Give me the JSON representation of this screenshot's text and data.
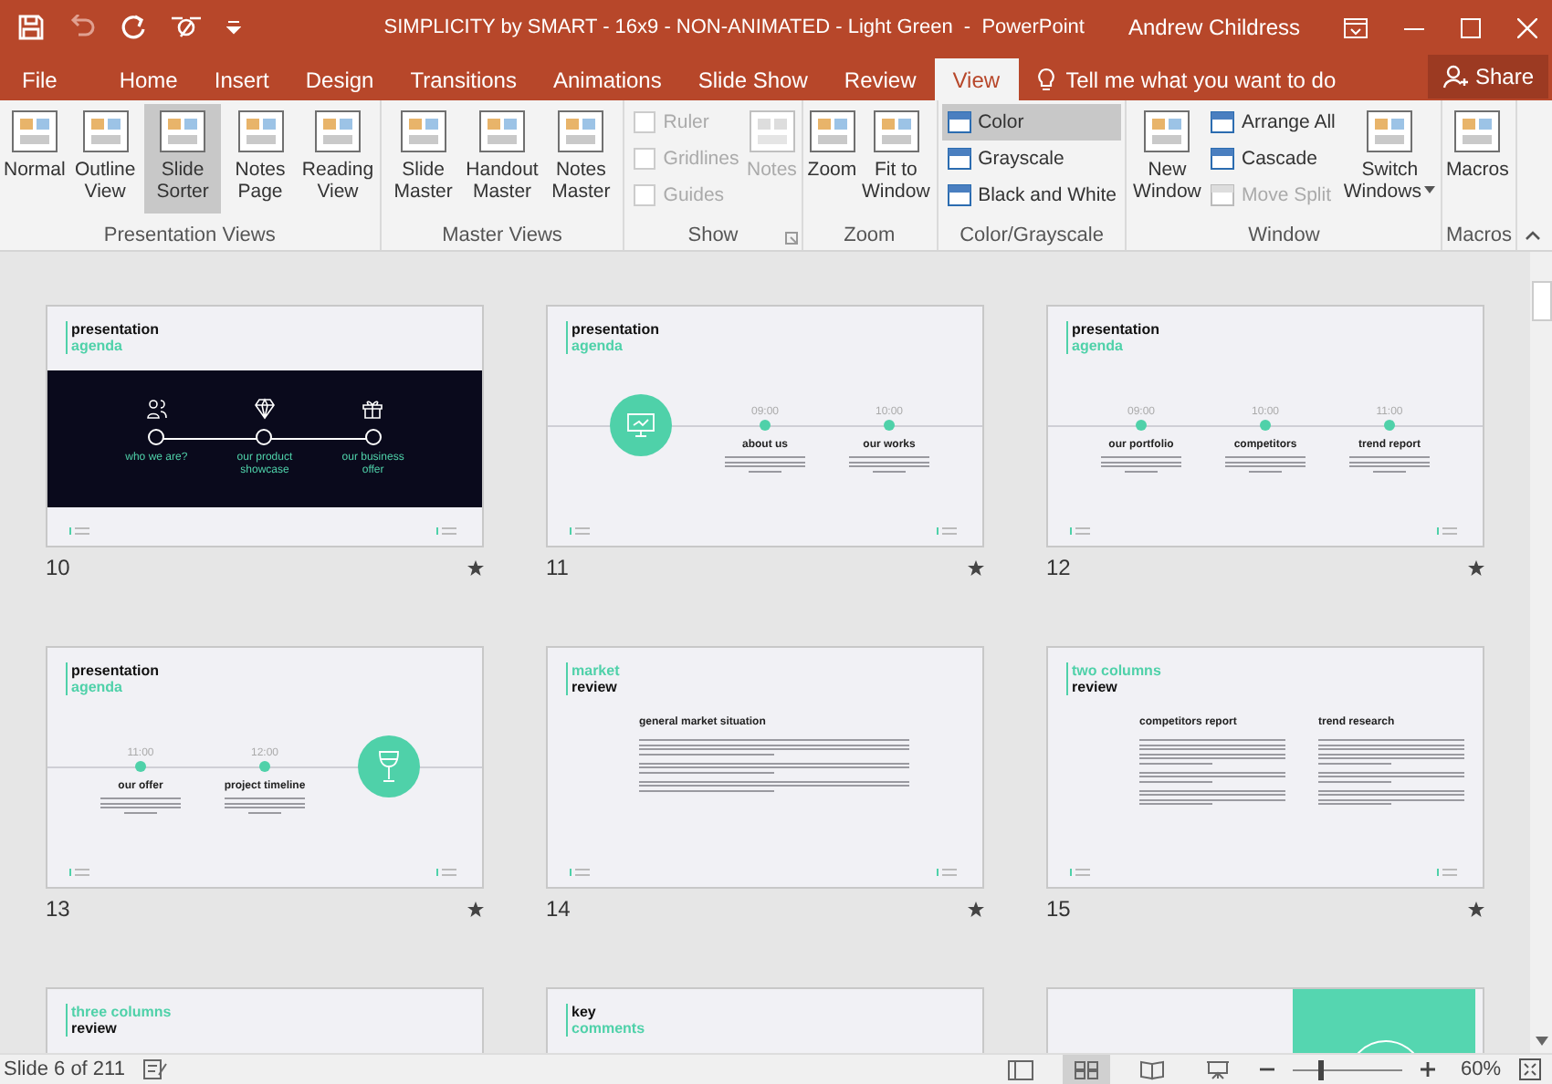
{
  "title_bar": {
    "title": "SIMPLICITY by SMART - 16x9 - NON-ANIMATED - Light Green  -  PowerPoint",
    "user": "Andrew Childress"
  },
  "tabs": [
    {
      "label": "File",
      "selected": false
    },
    {
      "label": "Home",
      "selected": false
    },
    {
      "label": "Insert",
      "selected": false
    },
    {
      "label": "Design",
      "selected": false
    },
    {
      "label": "Transitions",
      "selected": false
    },
    {
      "label": "Animations",
      "selected": false
    },
    {
      "label": "Slide Show",
      "selected": false
    },
    {
      "label": "Review",
      "selected": false
    },
    {
      "label": "View",
      "selected": true
    }
  ],
  "tell_me": {
    "placeholder": "Tell me what you want to do"
  },
  "share": "Share",
  "ribbon": {
    "groups": [
      {
        "label": "Presentation Views",
        "columns": [
          [
            {
              "kind": "large",
              "label": "Normal",
              "selected": false,
              "disabled": false
            }
          ],
          [
            {
              "kind": "large",
              "label": "Outline View",
              "selected": false,
              "disabled": false
            }
          ],
          [
            {
              "kind": "large",
              "label": "Slide Sorter",
              "selected": true,
              "disabled": false
            }
          ],
          [
            {
              "kind": "large",
              "label": "Notes Page",
              "selected": false,
              "disabled": false
            }
          ],
          [
            {
              "kind": "large",
              "label": "Reading View",
              "selected": false,
              "disabled": false
            }
          ]
        ]
      },
      {
        "label": "Master Views",
        "columns": [
          [
            {
              "kind": "large",
              "label": "Slide Master",
              "selected": false,
              "disabled": false
            }
          ],
          [
            {
              "kind": "large",
              "label": "Handout Master",
              "selected": false,
              "disabled": false
            }
          ],
          [
            {
              "kind": "large",
              "label": "Notes Master",
              "selected": false,
              "disabled": false
            }
          ]
        ]
      },
      {
        "label": "Show",
        "dialog_launcher": true,
        "columns": [
          [
            {
              "kind": "check",
              "label": "Ruler",
              "checked": false,
              "disabled": true
            },
            {
              "kind": "check",
              "label": "Gridlines",
              "checked": false,
              "disabled": true
            },
            {
              "kind": "check",
              "label": "Guides",
              "checked": false,
              "disabled": true
            }
          ],
          [
            {
              "kind": "large",
              "label": "Notes",
              "selected": false,
              "disabled": true
            }
          ]
        ]
      },
      {
        "label": "Zoom",
        "columns": [
          [
            {
              "kind": "large",
              "label": "Zoom",
              "selected": false,
              "disabled": false
            }
          ],
          [
            {
              "kind": "large",
              "label": "Fit to Window",
              "selected": false,
              "disabled": false
            }
          ]
        ]
      },
      {
        "label": "Color/Grayscale",
        "columns": [
          [
            {
              "kind": "small",
              "label": "Color",
              "selected": true,
              "disabled": false
            },
            {
              "kind": "small",
              "label": "Grayscale",
              "selected": false,
              "disabled": false
            },
            {
              "kind": "small",
              "label": "Black and White",
              "selected": false,
              "disabled": false
            }
          ]
        ]
      },
      {
        "label": "Window",
        "columns": [
          [
            {
              "kind": "large",
              "label": "New Window",
              "selected": false,
              "disabled": false
            }
          ],
          [
            {
              "kind": "small",
              "label": "Arrange All",
              "selected": false,
              "disabled": false
            },
            {
              "kind": "small",
              "label": "Cascade",
              "selected": false,
              "disabled": false
            },
            {
              "kind": "small",
              "label": "Move Split",
              "selected": false,
              "disabled": true
            }
          ],
          [
            {
              "kind": "large",
              "label": "Switch Windows",
              "selected": false,
              "disabled": false,
              "dropdown": true
            }
          ]
        ]
      },
      {
        "label": "Macros",
        "columns": [
          [
            {
              "kind": "large",
              "label": "Macros",
              "selected": false,
              "disabled": false
            }
          ]
        ]
      }
    ]
  },
  "slides": [
    {
      "number": "10",
      "transition": true,
      "kind": "banner",
      "title": [
        {
          "text": "presentation",
          "accent": false
        },
        {
          "text": "agenda",
          "accent": true
        }
      ],
      "items": [
        {
          "label": "who we are?"
        },
        {
          "label": "our product showcase"
        },
        {
          "label": "our business offer"
        }
      ]
    },
    {
      "number": "11",
      "transition": true,
      "kind": "timeline",
      "title": [
        {
          "text": "presentation",
          "accent": false
        },
        {
          "text": "agenda",
          "accent": true
        }
      ],
      "stops": [
        {
          "kind": "badge"
        },
        {
          "kind": "stop",
          "time": "09:00",
          "label": "about us"
        },
        {
          "kind": "stop",
          "time": "10:00",
          "label": "our works"
        }
      ]
    },
    {
      "number": "12",
      "transition": true,
      "kind": "timeline",
      "title": [
        {
          "text": "presentation",
          "accent": false
        },
        {
          "text": "agenda",
          "accent": true
        }
      ],
      "stops": [
        {
          "kind": "stop",
          "time": "09:00",
          "label": "our portfolio"
        },
        {
          "kind": "stop",
          "time": "10:00",
          "label": "competitors"
        },
        {
          "kind": "stop",
          "time": "11:00",
          "label": "trend report"
        }
      ]
    },
    {
      "number": "13",
      "transition": true,
      "kind": "timeline",
      "title": [
        {
          "text": "presentation",
          "accent": false
        },
        {
          "text": "agenda",
          "accent": true
        }
      ],
      "stops": [
        {
          "kind": "stop",
          "time": "11:00",
          "label": "our offer"
        },
        {
          "kind": "stop",
          "time": "12:00",
          "label": "project timeline"
        },
        {
          "kind": "badge"
        }
      ]
    },
    {
      "number": "14",
      "transition": true,
      "kind": "text",
      "title": [
        {
          "text": "market",
          "accent": true
        },
        {
          "text": "review",
          "accent": false
        }
      ],
      "columns": [
        {
          "heading": "general market situation"
        }
      ]
    },
    {
      "number": "15",
      "transition": true,
      "kind": "text",
      "title": [
        {
          "text": "two columns",
          "accent": true
        },
        {
          "text": "review",
          "accent": false
        }
      ],
      "columns": [
        {
          "heading": "competitors report"
        },
        {
          "heading": "trend research"
        }
      ]
    },
    {
      "kind": "text",
      "title": [
        {
          "text": "three columns",
          "accent": true
        },
        {
          "text": "review",
          "accent": false
        }
      ]
    },
    {
      "kind": "text",
      "title": [
        {
          "text": "key",
          "accent": false
        },
        {
          "text": "comments",
          "accent": true
        }
      ]
    },
    {
      "kind": "panel"
    }
  ],
  "status_bar": {
    "slide": "Slide 6 of 211",
    "views": [
      {
        "selected": false
      },
      {
        "selected": true
      },
      {
        "selected": false
      },
      {
        "selected": false
      }
    ],
    "zoom": {
      "level": 0.25,
      "reading": "60%"
    }
  }
}
